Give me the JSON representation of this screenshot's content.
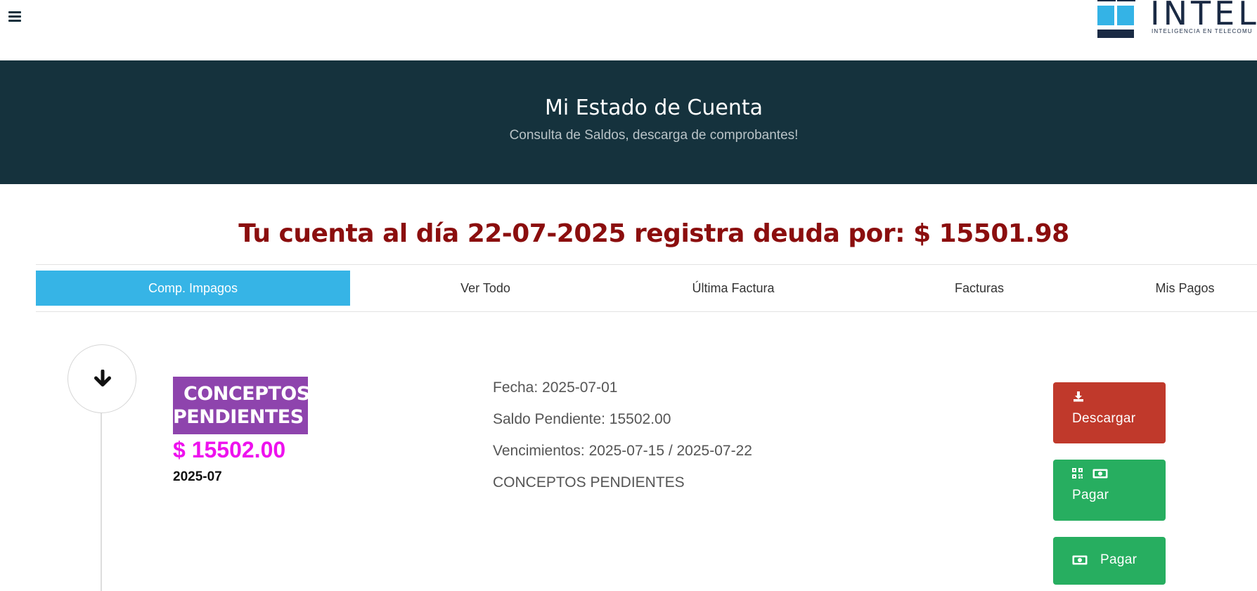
{
  "logo": {
    "name": "INTELIN",
    "tagline": "INTELIGENCIA EN TELECOMU"
  },
  "hero": {
    "title": "Mi Estado de Cuenta",
    "subtitle": "Consulta de Saldos, descarga de comprobantes!"
  },
  "debt_message": "Tu cuenta al día 22-07-2025 registra deuda por: $ 15501.98",
  "tabs": [
    {
      "label": "Comp. Impagos",
      "active": true
    },
    {
      "label": "Ver Todo",
      "active": false
    },
    {
      "label": "Última Factura",
      "active": false
    },
    {
      "label": "Facturas",
      "active": false
    },
    {
      "label": "Mis Pagos",
      "active": false
    }
  ],
  "item": {
    "title_line1": "CONCEPTOS",
    "title_line2": "PENDIENTES",
    "amount": "$ 15502.00",
    "period": "2025-07",
    "fecha": "Fecha: 2025-07-01",
    "saldo": "Saldo Pendiente: 15502.00",
    "vencimientos": "Vencimientos: 2025-07-15 / 2025-07-22",
    "description": "CONCEPTOS PENDIENTES"
  },
  "buttons": {
    "descargar": "Descargar",
    "pagar_qr": "Pagar",
    "pagar": "Pagar"
  },
  "colors": {
    "hero_bg": "#15323d",
    "tab_active": "#36b4e6",
    "debt_text": "#8b0e0e",
    "item_title_bg": "#8e44ad",
    "amount": "#ee11ee",
    "btn_red": "#c0392b",
    "btn_green": "#27ae60"
  },
  "icons": {
    "menu": "hamburger-icon",
    "timeline": "arrow-down-icon",
    "download": "download-icon",
    "qr": "qr-code-icon",
    "money": "money-bill-icon"
  }
}
